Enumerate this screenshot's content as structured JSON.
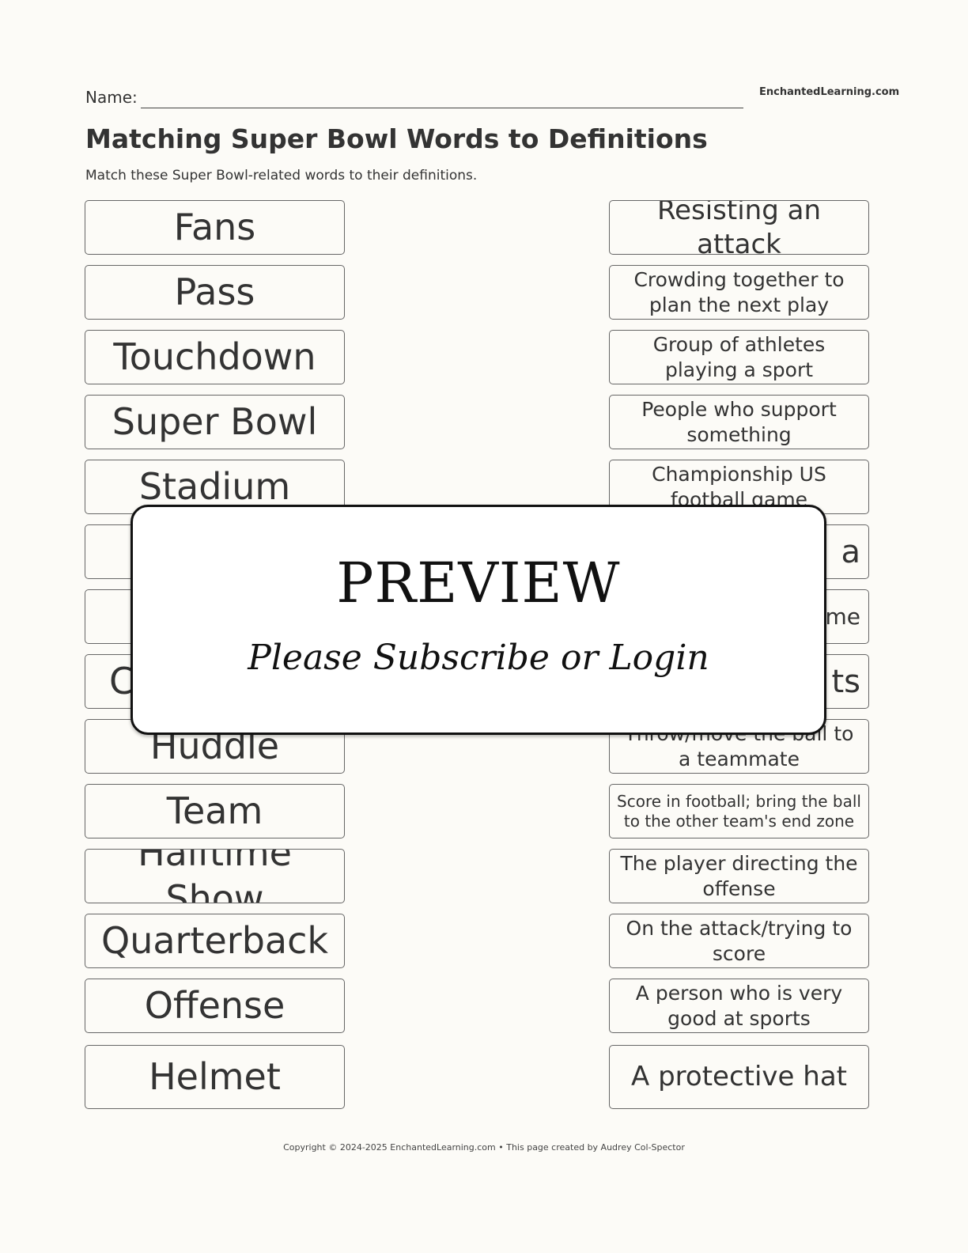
{
  "header": {
    "name_label": "Name:",
    "site": "EnchantedLearning.com",
    "title": "Matching Super Bowl Words to Definitions",
    "instructions": "Match these Super Bowl-related words to their definitions."
  },
  "words": [
    "Fans",
    "Pass",
    "Touchdown",
    "Super Bowl",
    "Stadium",
    "",
    "",
    "C",
    "Huddle",
    "Team",
    "Halftime Show",
    "Quarterback",
    "Offense",
    "Helmet"
  ],
  "definitions": [
    "Resisting an attack",
    "Crowding together to plan the next play",
    "Group of athletes playing a sport",
    "People who support something",
    "Championship US football game",
    "a",
    "me",
    "ts",
    "Throw/move the ball to a teammate",
    "Score in football; bring the ball to the other team's end zone",
    "The player directing the offense",
    "On the attack/trying to score",
    "A person who is very good at sports",
    "A protective hat"
  ],
  "overlay": {
    "title": "PREVIEW",
    "subtitle": "Please Subscribe or Login"
  },
  "footer": "Copyright © 2024-2025 EnchantedLearning.com • This page created by Audrey Col-Spector"
}
